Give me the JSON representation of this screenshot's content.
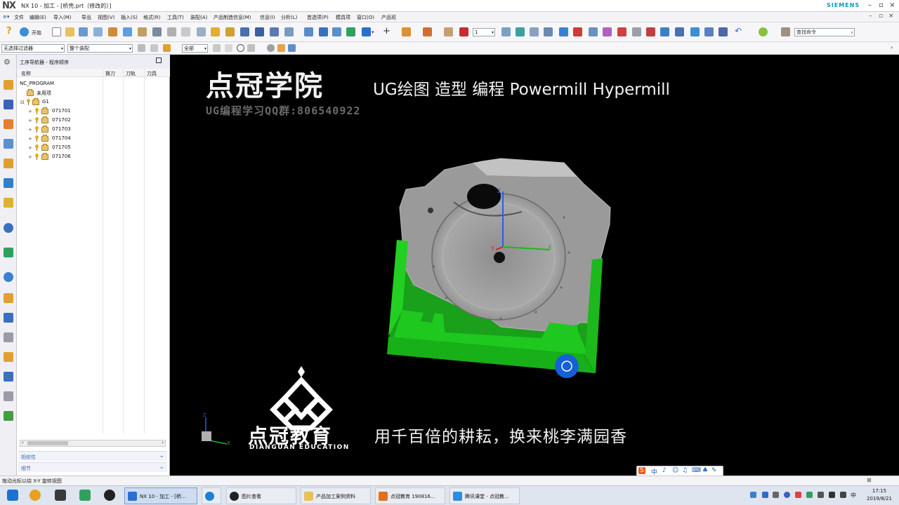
{
  "window": {
    "logo": "NX",
    "title": "NX 10 - 加工 - [桥壳.prt（修改的）]",
    "brand": "SIEMENS"
  },
  "menu": {
    "button_label": "菜单(M)",
    "items": [
      "文件",
      "编辑(E)",
      "导入(M)",
      "导出",
      "视图(V)",
      "插入(S)",
      "格式(R)",
      "工具(T)",
      "装配(A)",
      "产品制造信息(M)",
      "信息(I)",
      "分析(L)",
      "首选项(P)",
      "模具项",
      "窗口(O)",
      "产品班"
    ]
  },
  "toolbar": {
    "start_label": "开始",
    "layer_value": "1",
    "command_search_placeholder": "查找命令"
  },
  "toolbar2": {
    "filter_value": "无选择过滤器",
    "assembly_scope": "整个装配",
    "snap_scope": "全部"
  },
  "navigator": {
    "title": "工序导航器 - 程序顺序",
    "columns": [
      "名称",
      "换刀",
      "刀轨",
      "刀具"
    ],
    "root": "NC_PROGRAM",
    "unused": "未用项",
    "group": "G1",
    "programs": [
      "071701",
      "071702",
      "071703",
      "071704",
      "071705",
      "071706"
    ],
    "panels": [
      "相依性",
      "细节"
    ]
  },
  "viewport": {
    "title": "点冠学院",
    "subtitle": "UG绘图 造型 编程 Powermill Hypermill",
    "qq_group": "UG编程学习QQ群:806540922",
    "edu_name_cn": "点冠教育",
    "edu_name_en": "DIANGUAN EDUCATION",
    "slogan": "用千百倍的耕耘，换来桃李满园香",
    "axis_labels": {
      "x": "X",
      "y": "Y",
      "z": "Z"
    },
    "ime_symbol": "S",
    "ime_mode": "中"
  },
  "status": {
    "message": "拖动光标以绕 X-Y 旋转视图"
  },
  "taskbar": {
    "tasks": [
      {
        "label": "NX 10 - 加工 - [桥..."
      },
      {
        "label": ""
      },
      {
        "label": "图片查看"
      },
      {
        "label": "产品加工案例资料"
      },
      {
        "label": "点冠教育 190816..."
      },
      {
        "label": "腾讯课堂 - 点冠教..."
      }
    ],
    "ime_indicator": "中",
    "time": "17:15",
    "date": "2019/8/21"
  },
  "colors": {
    "fixture_green": "#1ec81e",
    "part_gray": "#9a9a9a",
    "accent_blue": "#1560d8",
    "siemens_teal": "#00a0b0"
  }
}
